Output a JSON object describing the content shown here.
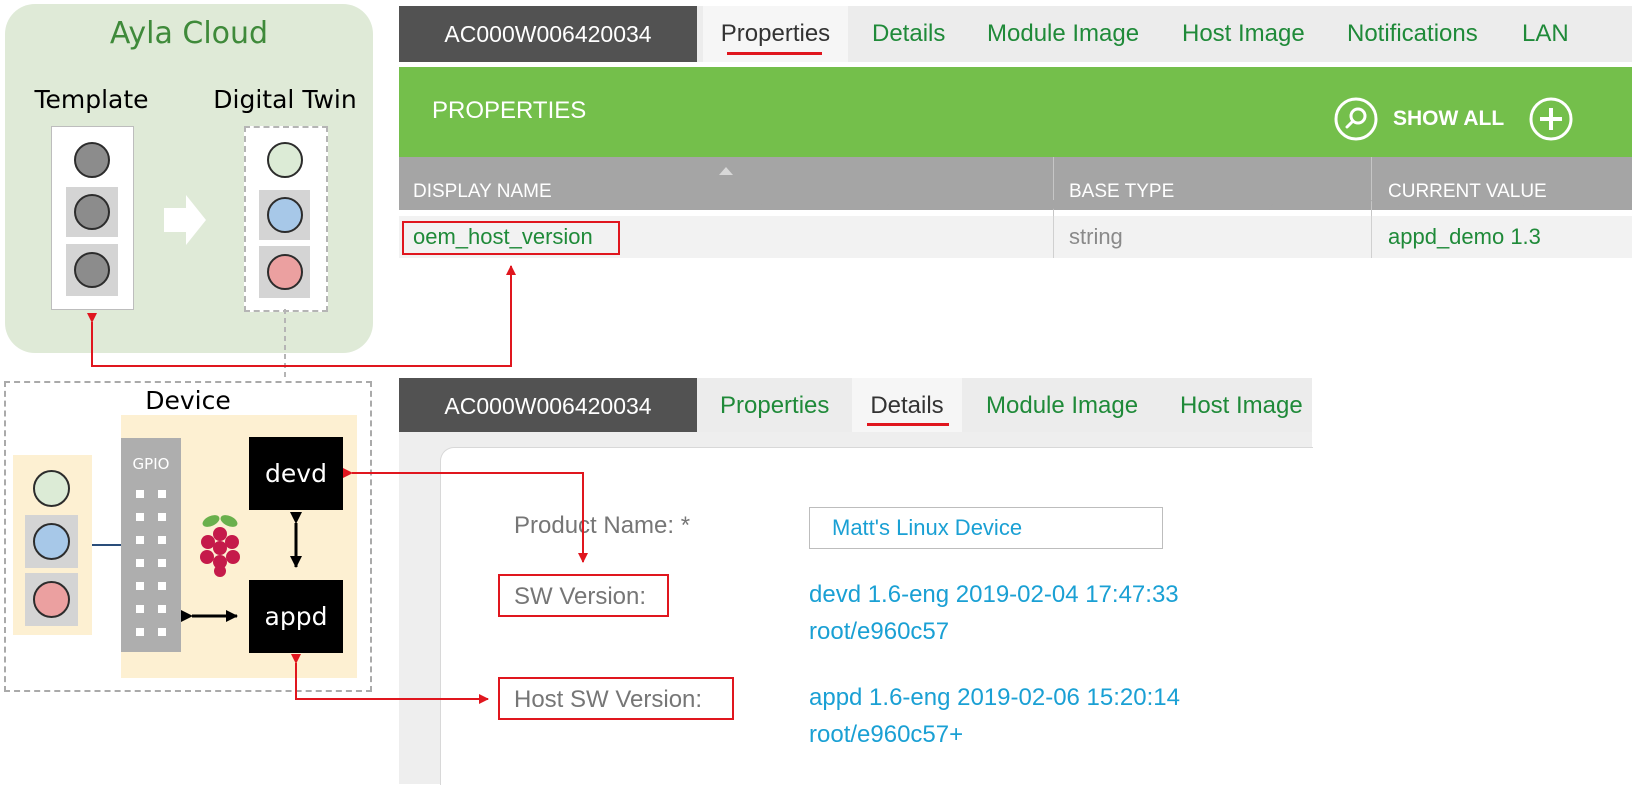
{
  "diagram": {
    "cloud_title": "Ayla Cloud",
    "template_label": "Template",
    "twin_label": "Digital Twin",
    "device_label": "Device",
    "gpio_label": "GPIO",
    "devd_label": "devd",
    "appd_label": "appd"
  },
  "properties_view": {
    "device_id": "AC000W006420034",
    "tabs": [
      "Properties",
      "Details",
      "Module Image",
      "Host Image",
      "Notifications",
      "LAN"
    ],
    "active_tab": "Properties",
    "section_title": "PROPERTIES",
    "show_all_label": "SHOW ALL",
    "columns": [
      "DISPLAY NAME",
      "BASE TYPE",
      "CURRENT VALUE"
    ],
    "row": {
      "display_name": "oem_host_version",
      "base_type": "string",
      "current_value": "appd_demo 1.3"
    }
  },
  "details_view": {
    "device_id": "AC000W006420034",
    "tabs": [
      "Properties",
      "Details",
      "Module Image",
      "Host Image"
    ],
    "active_tab": "Details",
    "product_name_label": "Product Name: *",
    "product_name_value": "Matt's Linux Device",
    "sw_version_label": "SW Version:",
    "sw_version_line1": "devd 1.6-eng 2019-02-04 17:47:33",
    "sw_version_line2": "root/e960c57",
    "host_sw_version_label": "Host SW Version:",
    "host_sw_version_line1": "appd 1.6-eng 2019-02-06 15:20:14",
    "host_sw_version_line2": "root/e960c57+"
  },
  "colors": {
    "accent_green": "#74bf4b",
    "link_green": "#1f8a39",
    "highlight_red": "#e0161e",
    "value_blue": "#1aa0d4",
    "dot_light_green": "#dcebd6",
    "dot_blue": "#a7c8e8",
    "dot_pink": "#eba0a0",
    "dot_gray": "#8c8c8c"
  }
}
